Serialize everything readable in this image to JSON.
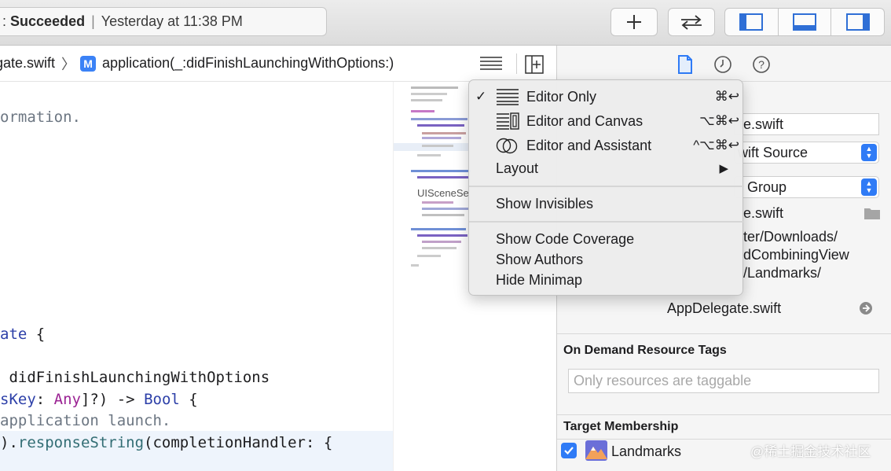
{
  "toolbar": {
    "status_prefix": ":",
    "status_result": "Succeeded",
    "status_separator": "|",
    "status_time": "Yesterday at 11:38 PM",
    "add_icon": "plus-icon",
    "swap_icon": "swap-arrows-icon",
    "layout_icons": [
      "navigator-panel-icon",
      "debug-panel-icon",
      "inspector-panel-icon"
    ]
  },
  "jumpbar": {
    "file": "gate.swift",
    "method_badge": "M",
    "method": "application(_:didFinishLaunchingWithOptions:)"
  },
  "editor": {
    "lines": {
      "l1": "ormation.",
      "l2_a": "ate",
      "l2_b": " {",
      "l3": " didFinishLaunchingWithOptions",
      "l4_a": "sKey",
      "l4_b": ": ",
      "l4_c": "Any",
      "l4_d": "]?) -> ",
      "l4_e": "Bool",
      "l4_f": " {",
      "l5": "application launch.",
      "l6_a": ").",
      "l6_b": "responseString",
      "l6_c": "(completionHandler: {"
    }
  },
  "minimap": {
    "label": "UISceneSe"
  },
  "menu": {
    "items": [
      {
        "label": "Editor Only",
        "shortcut": "⌘↩",
        "checked": "✓"
      },
      {
        "label": "Editor and Canvas",
        "shortcut": "⌥⌘↩"
      },
      {
        "label": "Editor and Assistant",
        "shortcut": "^⌥⌘↩"
      },
      {
        "label": "Layout",
        "submenu": "▶"
      },
      {
        "label": "Show Invisibles"
      },
      {
        "label": "Show Code Coverage"
      },
      {
        "label": "Show Authors"
      },
      {
        "label": "Hide Minimap"
      }
    ]
  },
  "inspector": {
    "name_field": "te.swift",
    "type_popup": "wift Source",
    "location_popup": "Group",
    "filename": "e.swift",
    "path_lines": [
      "ter/Downloads/",
      "dCombiningView",
      "/Landmarks/"
    ],
    "full_path_file": "AppDelegate.swift",
    "on_demand_title": "On Demand Resource Tags",
    "on_demand_placeholder": "Only resources are taggable",
    "target_title": "Target Membership",
    "target_name": "Landmarks",
    "target_checked": true
  },
  "watermark": "@稀土掘金技术社区",
  "colors": {
    "accent": "#2f7bf6",
    "keyword": "#9b2393",
    "type": "#2c3fa8",
    "call": "#326d74",
    "comment": "#6c7682"
  }
}
